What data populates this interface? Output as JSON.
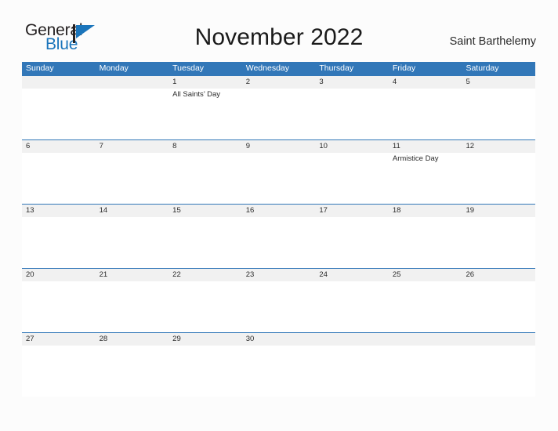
{
  "brand": {
    "name_part1": "General",
    "name_part2": "Blue",
    "flag_icon": "blue-flag-icon",
    "accent_color": "#1b75bb"
  },
  "header": {
    "title": "November 2022",
    "subtitle": "Saint Barthelemy"
  },
  "calendar": {
    "header_color": "#3277b8",
    "daynum_band_color": "#f1f1f1",
    "weekdays": [
      "Sunday",
      "Monday",
      "Tuesday",
      "Wednesday",
      "Thursday",
      "Friday",
      "Saturday"
    ],
    "weeks": [
      {
        "days": [
          {
            "num": "",
            "event": ""
          },
          {
            "num": "",
            "event": ""
          },
          {
            "num": "1",
            "event": "All Saints’ Day"
          },
          {
            "num": "2",
            "event": ""
          },
          {
            "num": "3",
            "event": ""
          },
          {
            "num": "4",
            "event": ""
          },
          {
            "num": "5",
            "event": ""
          }
        ]
      },
      {
        "days": [
          {
            "num": "6",
            "event": ""
          },
          {
            "num": "7",
            "event": ""
          },
          {
            "num": "8",
            "event": ""
          },
          {
            "num": "9",
            "event": ""
          },
          {
            "num": "10",
            "event": ""
          },
          {
            "num": "11",
            "event": "Armistice Day"
          },
          {
            "num": "12",
            "event": ""
          }
        ]
      },
      {
        "days": [
          {
            "num": "13",
            "event": ""
          },
          {
            "num": "14",
            "event": ""
          },
          {
            "num": "15",
            "event": ""
          },
          {
            "num": "16",
            "event": ""
          },
          {
            "num": "17",
            "event": ""
          },
          {
            "num": "18",
            "event": ""
          },
          {
            "num": "19",
            "event": ""
          }
        ]
      },
      {
        "days": [
          {
            "num": "20",
            "event": ""
          },
          {
            "num": "21",
            "event": ""
          },
          {
            "num": "22",
            "event": ""
          },
          {
            "num": "23",
            "event": ""
          },
          {
            "num": "24",
            "event": ""
          },
          {
            "num": "25",
            "event": ""
          },
          {
            "num": "26",
            "event": ""
          }
        ]
      },
      {
        "days": [
          {
            "num": "27",
            "event": ""
          },
          {
            "num": "28",
            "event": ""
          },
          {
            "num": "29",
            "event": ""
          },
          {
            "num": "30",
            "event": ""
          },
          {
            "num": "",
            "event": ""
          },
          {
            "num": "",
            "event": ""
          },
          {
            "num": "",
            "event": ""
          }
        ]
      }
    ]
  }
}
